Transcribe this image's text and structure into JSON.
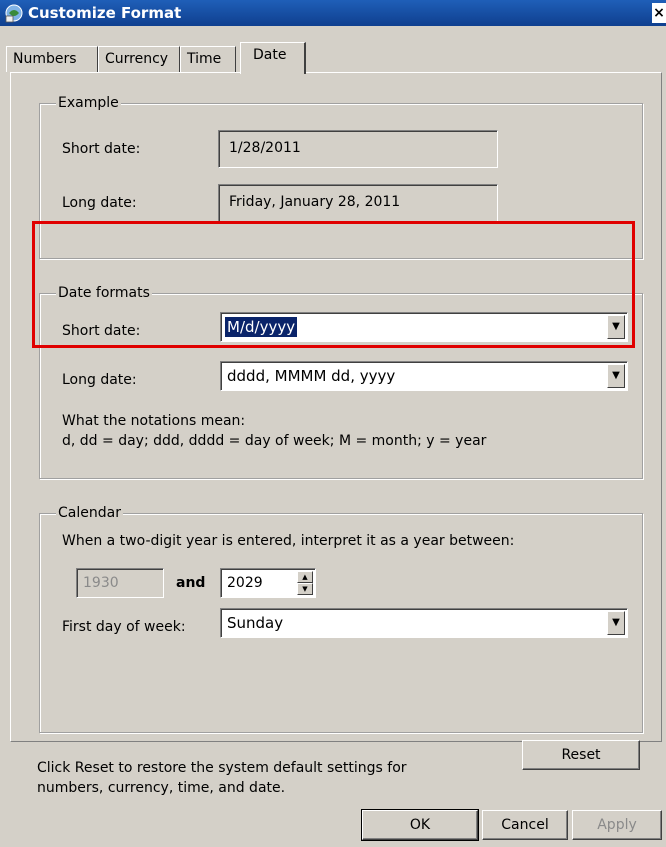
{
  "window": {
    "title": "Customize Format",
    "close_glyph": "×"
  },
  "tabs": [
    {
      "label": "Numbers"
    },
    {
      "label": "Currency"
    },
    {
      "label": "Time"
    },
    {
      "label": "Date",
      "active": true
    }
  ],
  "example": {
    "title": "Example",
    "short_label": "Short date:",
    "short_value": "1/28/2011",
    "long_label": "Long date:",
    "long_value": "Friday, January 28, 2011"
  },
  "date_formats": {
    "title": "Date formats",
    "short_label": "Short date:",
    "short_value": "M/d/yyyy",
    "long_label": "Long date:",
    "long_value": "dddd, MMMM dd, yyyy",
    "notation_heading": "What the notations mean:",
    "notation_text": "d, dd = day;  ddd, dddd = day of week;  M = month;  y = year"
  },
  "calendar": {
    "title": "Calendar",
    "two_digit_text": "When a two-digit year is entered, interpret it as a year between:",
    "year_start": "1930",
    "and_label": "and",
    "year_end": "2029",
    "first_day_label": "First day of week:",
    "first_day_value": "Sunday"
  },
  "footer": {
    "reset_text_line1": "Click Reset to restore the system default settings for",
    "reset_text_line2": "numbers, currency, time, and date.",
    "reset_button": "Reset",
    "ok_button": "OK",
    "cancel_button": "Cancel",
    "apply_button": "Apply"
  },
  "colors": {
    "highlight": "#e00000",
    "selection": "#0a246a",
    "dialog_bg": "#d4d0c8"
  }
}
